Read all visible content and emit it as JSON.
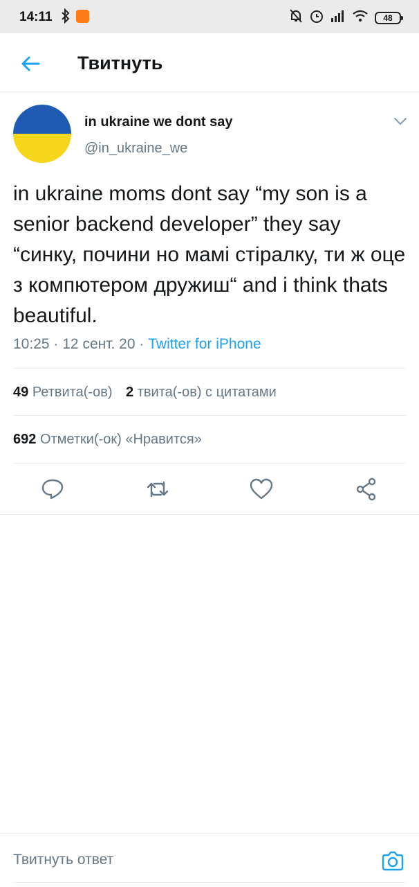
{
  "status_bar": {
    "time": "14:11",
    "battery": "48"
  },
  "header": {
    "title": "Твитнуть"
  },
  "tweet": {
    "display_name": "in ukraine we dont say",
    "username": "@in_ukraine_we",
    "text": "in ukraine moms dont say “my son is a senior backend developer” they say “синку, почини но мамі стіралку, ти ж оце з компютером дружиш“ and i think thats beautiful.",
    "time": "10:25",
    "date": "12 сент. 20",
    "separator": "·",
    "source": "Twitter for iPhone",
    "retweets_count": "49",
    "retweets_label": "Ретвита(-ов)",
    "quotes_count": "2",
    "quotes_label": "твита(-ов) с цитатами",
    "likes_count": "692",
    "likes_label": "Отметки(-ок) «Нравится»"
  },
  "actions": [
    "reply-icon",
    "retweet-icon",
    "like-icon",
    "share-icon"
  ],
  "reply_bar": {
    "placeholder": "Твитнуть ответ"
  },
  "colors": {
    "accent": "#1da1f2",
    "text_primary": "#14171a",
    "text_secondary": "#657786",
    "flag_blue": "#1f5bb3",
    "flag_yellow": "#f5d61a"
  }
}
